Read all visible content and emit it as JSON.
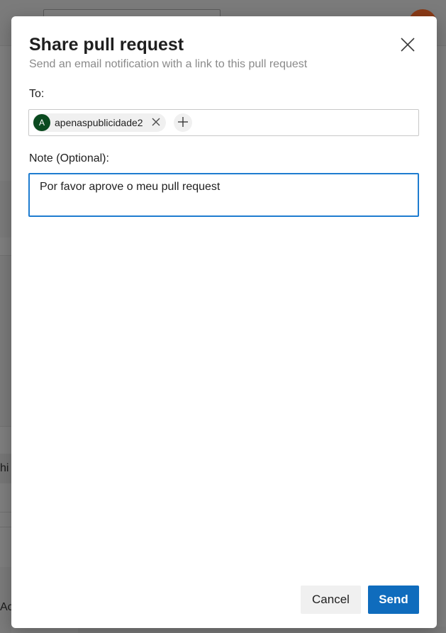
{
  "background": {
    "fragment_1": "hi",
    "fragment_2": "Act"
  },
  "dialog": {
    "title": "Share pull request",
    "subtitle": "Send an email notification with a link to this pull request",
    "close_icon": "close-icon"
  },
  "to": {
    "label": "To:",
    "recipients": [
      {
        "initial": "A",
        "name": "apenaspublicidade2",
        "avatar_color": "#0a4a1f"
      }
    ],
    "add_icon": "plus-icon",
    "remove_icon": "close-icon"
  },
  "note": {
    "label": "Note (Optional):",
    "value": "Por favor aprove o meu pull request"
  },
  "actions": {
    "cancel_label": "Cancel",
    "send_label": "Send"
  },
  "colors": {
    "accent": "#0f6cbd",
    "focus_border": "#1e7cd0",
    "overlay": "#7f7f7f"
  }
}
